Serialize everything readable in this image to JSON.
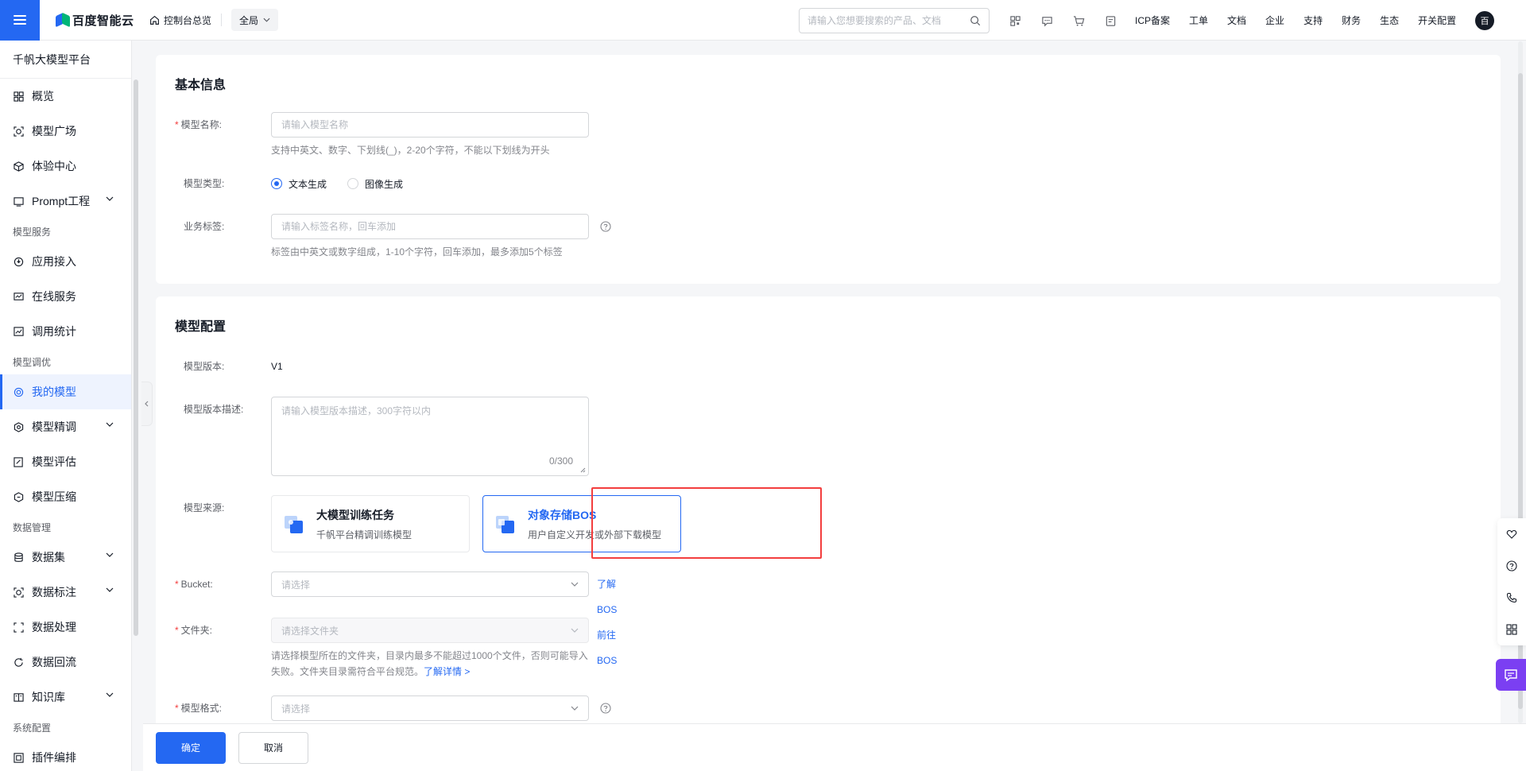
{
  "header": {
    "logo_text": "百度智能云",
    "home_label": "控制台总览",
    "region_label": "全局",
    "search_placeholder": "请输入您想要搜索的产品、文档",
    "nav": [
      "ICP备案",
      "工单",
      "文档",
      "企业",
      "支持",
      "财务",
      "生态",
      "开关配置"
    ],
    "avatar_letter": "百",
    "icons": [
      "qrcode-icon",
      "message-icon",
      "cart-icon",
      "billing-icon"
    ]
  },
  "sidebar": {
    "title": "千帆大模型平台",
    "groups": [
      {
        "label": "",
        "items": [
          {
            "label": "概览",
            "icon": "grid-icon"
          },
          {
            "label": "模型广场",
            "icon": "square-icon"
          },
          {
            "label": "体验中心",
            "icon": "cube-icon"
          },
          {
            "label": "Prompt工程",
            "icon": "prompt-icon",
            "expandable": true
          }
        ]
      },
      {
        "label": "模型服务",
        "items": [
          {
            "label": "应用接入",
            "icon": "plug-icon"
          },
          {
            "label": "在线服务",
            "icon": "monitor-icon"
          },
          {
            "label": "调用统计",
            "icon": "chart-icon"
          }
        ]
      },
      {
        "label": "模型调优",
        "items": [
          {
            "label": "我的模型",
            "icon": "target-icon",
            "active": true
          },
          {
            "label": "模型精调",
            "icon": "hexagon-icon",
            "expandable": true
          },
          {
            "label": "模型评估",
            "icon": "edit-icon"
          },
          {
            "label": "模型压缩",
            "icon": "compress-icon"
          }
        ]
      },
      {
        "label": "数据管理",
        "items": [
          {
            "label": "数据集",
            "icon": "database-icon",
            "expandable": true
          },
          {
            "label": "数据标注",
            "icon": "tag-icon",
            "expandable": true
          },
          {
            "label": "数据处理",
            "icon": "process-icon"
          },
          {
            "label": "数据回流",
            "icon": "refresh-icon"
          },
          {
            "label": "知识库",
            "icon": "book-icon",
            "expandable": true
          }
        ]
      },
      {
        "label": "系统配置",
        "items": [
          {
            "label": "插件编排",
            "icon": "plugin-icon"
          }
        ]
      }
    ]
  },
  "basic": {
    "title": "基本信息",
    "name_label": "模型名称:",
    "name_placeholder": "请输入模型名称",
    "name_help": "支持中英文、数字、下划线(_)，2-20个字符，不能以下划线为开头",
    "type_label": "模型类型:",
    "type_options": [
      "文本生成",
      "图像生成"
    ],
    "type_selected": "文本生成",
    "tag_label": "业务标签:",
    "tag_placeholder": "请输入标签名称，回车添加",
    "tag_help": "标签由中英文或数字组成，1-10个字符，回车添加，最多添加5个标签"
  },
  "config": {
    "title": "模型配置",
    "version_label": "模型版本:",
    "version_value": "V1",
    "desc_label": "模型版本描述:",
    "desc_placeholder": "请输入模型版本描述，300字符以内",
    "desc_count": "0/300",
    "source_label": "模型来源:",
    "sources": [
      {
        "title": "大模型训练任务",
        "desc": "千帆平台精调训练模型",
        "selected": false
      },
      {
        "title": "对象存储BOS",
        "desc": "用户自定义开发或外部下载模型",
        "selected": true
      }
    ],
    "bucket_label": "Bucket:",
    "bucket_placeholder": "请选择",
    "bucket_links": [
      "了解BOS",
      "前往BOS"
    ],
    "folder_label": "文件夹:",
    "folder_placeholder": "请选择文件夹",
    "folder_help": "请选择模型所在的文件夹，目录内最多不能超过1000个文件，否则可能导入失败。文件夹目录需符合平台规范。",
    "folder_help_link": "了解详情 >",
    "format_label": "模型格式:",
    "format_placeholder": "请选择"
  },
  "footer": {
    "confirm_label": "确定",
    "cancel_label": "取消"
  },
  "colors": {
    "primary": "#2468f2",
    "danger": "#f33e3e",
    "chat": "#7b3ff2"
  }
}
